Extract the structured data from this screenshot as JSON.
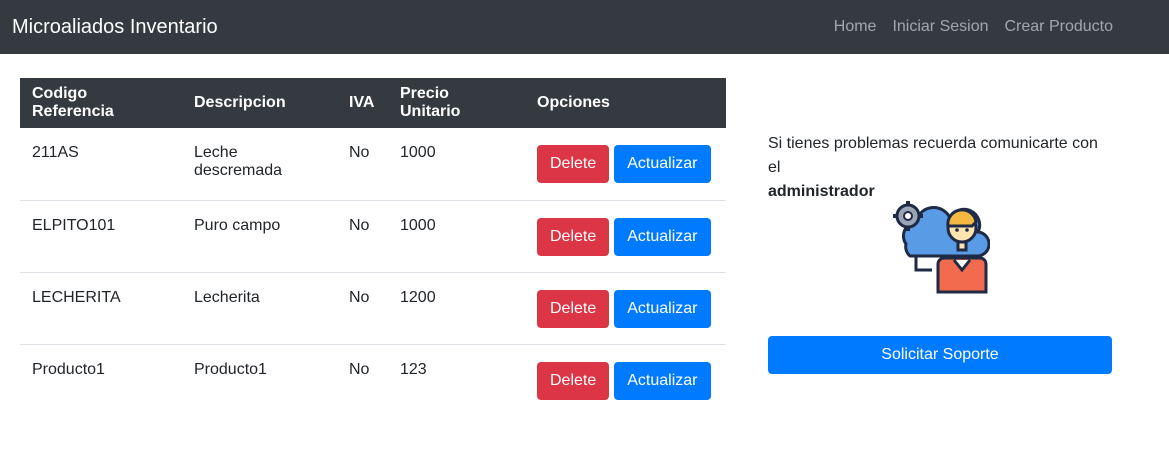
{
  "navbar": {
    "brand": "Microaliados Inventario",
    "links": [
      "Home",
      "Iniciar Sesion",
      "Crear Producto"
    ]
  },
  "table": {
    "headers": [
      "Codigo Referencia",
      "Descripcion",
      "IVA",
      "Precio Unitario",
      "Opciones"
    ],
    "rows": [
      {
        "codigo": "211AS",
        "descripcion": "Leche descremada",
        "iva": "No",
        "precio": "1000"
      },
      {
        "codigo": "ELPITO101",
        "descripcion": "Puro campo",
        "iva": "No",
        "precio": "1000"
      },
      {
        "codigo": "LECHERITA",
        "descripcion": "Lecherita",
        "iva": "No",
        "precio": "1200"
      },
      {
        "codigo": "Producto1",
        "descripcion": "Producto1",
        "iva": "No",
        "precio": "123"
      }
    ],
    "delete_label": "Delete",
    "update_label": "Actualizar"
  },
  "sidebar": {
    "message": "Si tienes problemas recuerda comunicarte con el",
    "message_bold": "administrador",
    "illustration_icon": "support-admin-icon",
    "support_button": "Solicitar Soporte"
  },
  "colors": {
    "navbar": "#343a40",
    "danger": "#dc3545",
    "primary": "#007bff"
  }
}
